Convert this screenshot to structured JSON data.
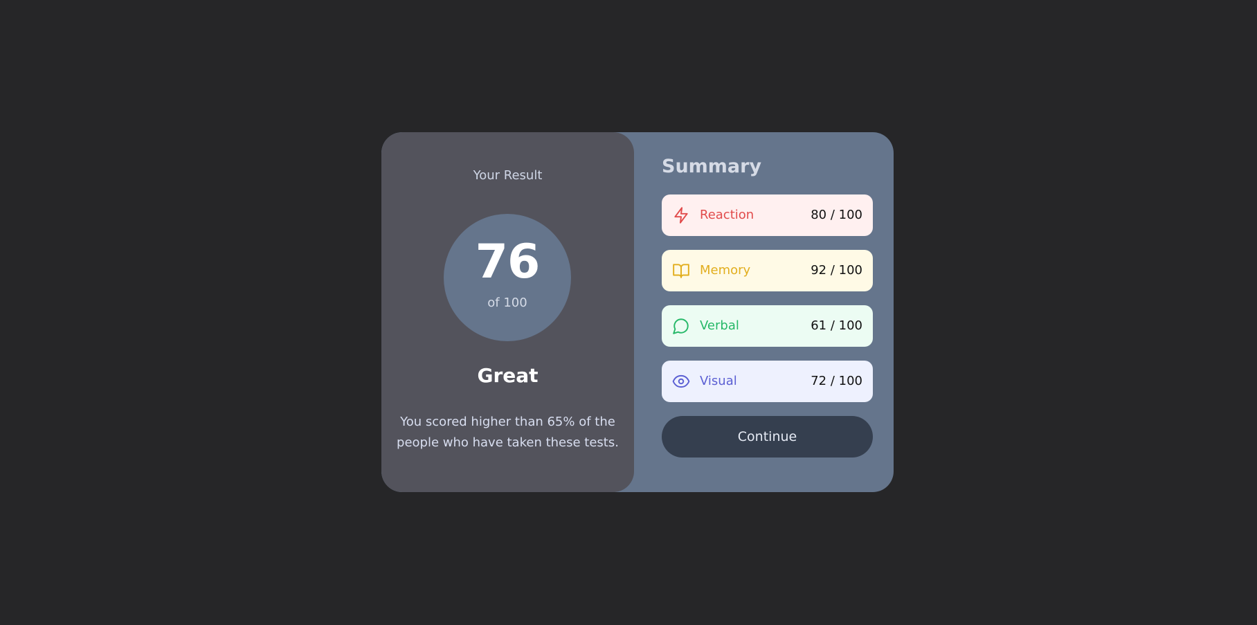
{
  "result": {
    "heading": "Your Result",
    "score": "76",
    "out_of": "of 100",
    "rating": "Great",
    "description": "You scored higher than 65% of the people who have taken these tests."
  },
  "summary": {
    "title": "Summary",
    "items": [
      {
        "label": "Reaction",
        "score": "80 / 100",
        "icon": "lightning-icon",
        "color": "#e14b4b",
        "bg": "#fff0f0"
      },
      {
        "label": "Memory",
        "score": "92 / 100",
        "icon": "book-icon",
        "color": "#e2ae1e",
        "bg": "#fffae6"
      },
      {
        "label": "Verbal",
        "score": "61 / 100",
        "icon": "chat-bubble-icon",
        "color": "#26b868",
        "bg": "#ecfcf3"
      },
      {
        "label": "Visual",
        "score": "72 / 100",
        "icon": "eye-icon",
        "color": "#5b5fd3",
        "bg": "#eef1fe"
      }
    ],
    "continue_label": "Continue"
  }
}
